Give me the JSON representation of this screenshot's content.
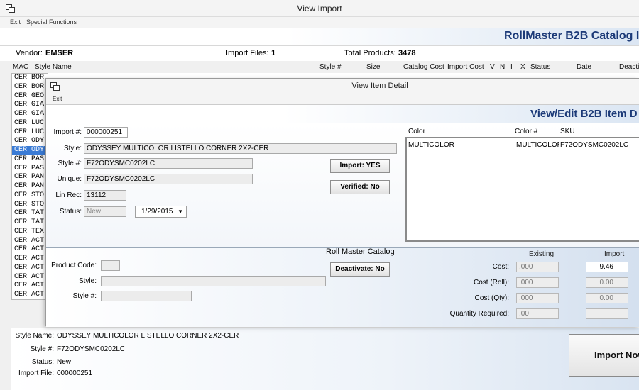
{
  "outer": {
    "title": "View Import",
    "menu": [
      "Exit",
      "Special Functions"
    ],
    "banner_title": "RollMaster B2B Catalog Ir",
    "vendor_label": "Vendor:",
    "vendor_value": "EMSER",
    "import_files_label": "Import Files:",
    "import_files_value": "1",
    "total_products_label": "Total Products:",
    "total_products_value": "3478",
    "columns": [
      "MAC",
      "Style Name",
      "Style #",
      "Size",
      "Catalog Cost",
      "Import Cost",
      "V",
      "N",
      "I",
      "X",
      "Status",
      "Date",
      "Deacti"
    ],
    "mac_rows": [
      "CER BOR",
      "CER BOR",
      "CER GEO",
      "CER GIA",
      "CER GIA",
      "CER LUC",
      "CER LUC",
      "CER ODY",
      "CER ODY",
      "CER PAS",
      "CER PAS",
      "CER PAN",
      "CER PAN",
      "CER STO",
      "CER STO",
      "CER TAT",
      "CER TAT",
      "CER TEX",
      "CER ACT",
      "CER ACT",
      "CER ACT",
      "CER ACT",
      "CER ACT",
      "CER ACT",
      "CER ACT"
    ],
    "selected_row": 8,
    "bottom": {
      "style_name_label": "Style Name:",
      "style_name_value": "ODYSSEY MULTICOLOR LISTELLO CORNER 2X2-CER",
      "style_num_label": "Style #:",
      "style_num_value": "F72ODYSMC0202LC",
      "status_label": "Status:",
      "status_value": "New",
      "import_file_label": "Import File:",
      "import_file_value": "000000251"
    },
    "import_now_label": "Import Now"
  },
  "inner": {
    "title": "View Item Detail",
    "menu_exit": "Exit",
    "banner_title": "View/Edit B2B Item D",
    "import_num_label": "Import #:",
    "import_num_value": "000000251",
    "style_label": "Style:",
    "style_value": "ODYSSEY MULTICOLOR LISTELLO CORNER 2X2-CER",
    "style_num_label": "Style #:",
    "style_num_value": "F72ODYSMC0202LC",
    "unique_label": "Unique:",
    "unique_value": "F72ODYSMC0202LC",
    "lin_rec_label": "Lin Rec:",
    "lin_rec_value": "13112",
    "status_label": "Status:",
    "status_value": "New",
    "date_value": "1/29/2015",
    "import_btn": "Import: YES",
    "verified_btn": "Verified: No",
    "color_headers": [
      "Color",
      "Color #",
      "SKU"
    ],
    "color_row": [
      "MULTICOLOR",
      "MULTICOLOR",
      "F72ODYSMC0202LC"
    ],
    "catalog_title": "Roll Master Catalog",
    "product_code_label": "Product Code:",
    "cat_style_label": "Style:",
    "cat_style_num_label": "Style #:",
    "deactivate_btn": "Deactivate: No",
    "existing_label": "Existing",
    "import_label": "Import",
    "cost_label": "Cost:",
    "cost_roll_label": "Cost (Roll):",
    "cost_qty_label": "Cost (Qty):",
    "qty_req_label": "Quantity Required:",
    "existing_cost": ".000",
    "existing_cost_roll": ".000",
    "existing_cost_qty": ".000",
    "existing_qty": ".00",
    "import_cost": "9.46",
    "import_cost_roll": "0.00",
    "import_cost_qty": "0.00",
    "import_qty": ""
  }
}
